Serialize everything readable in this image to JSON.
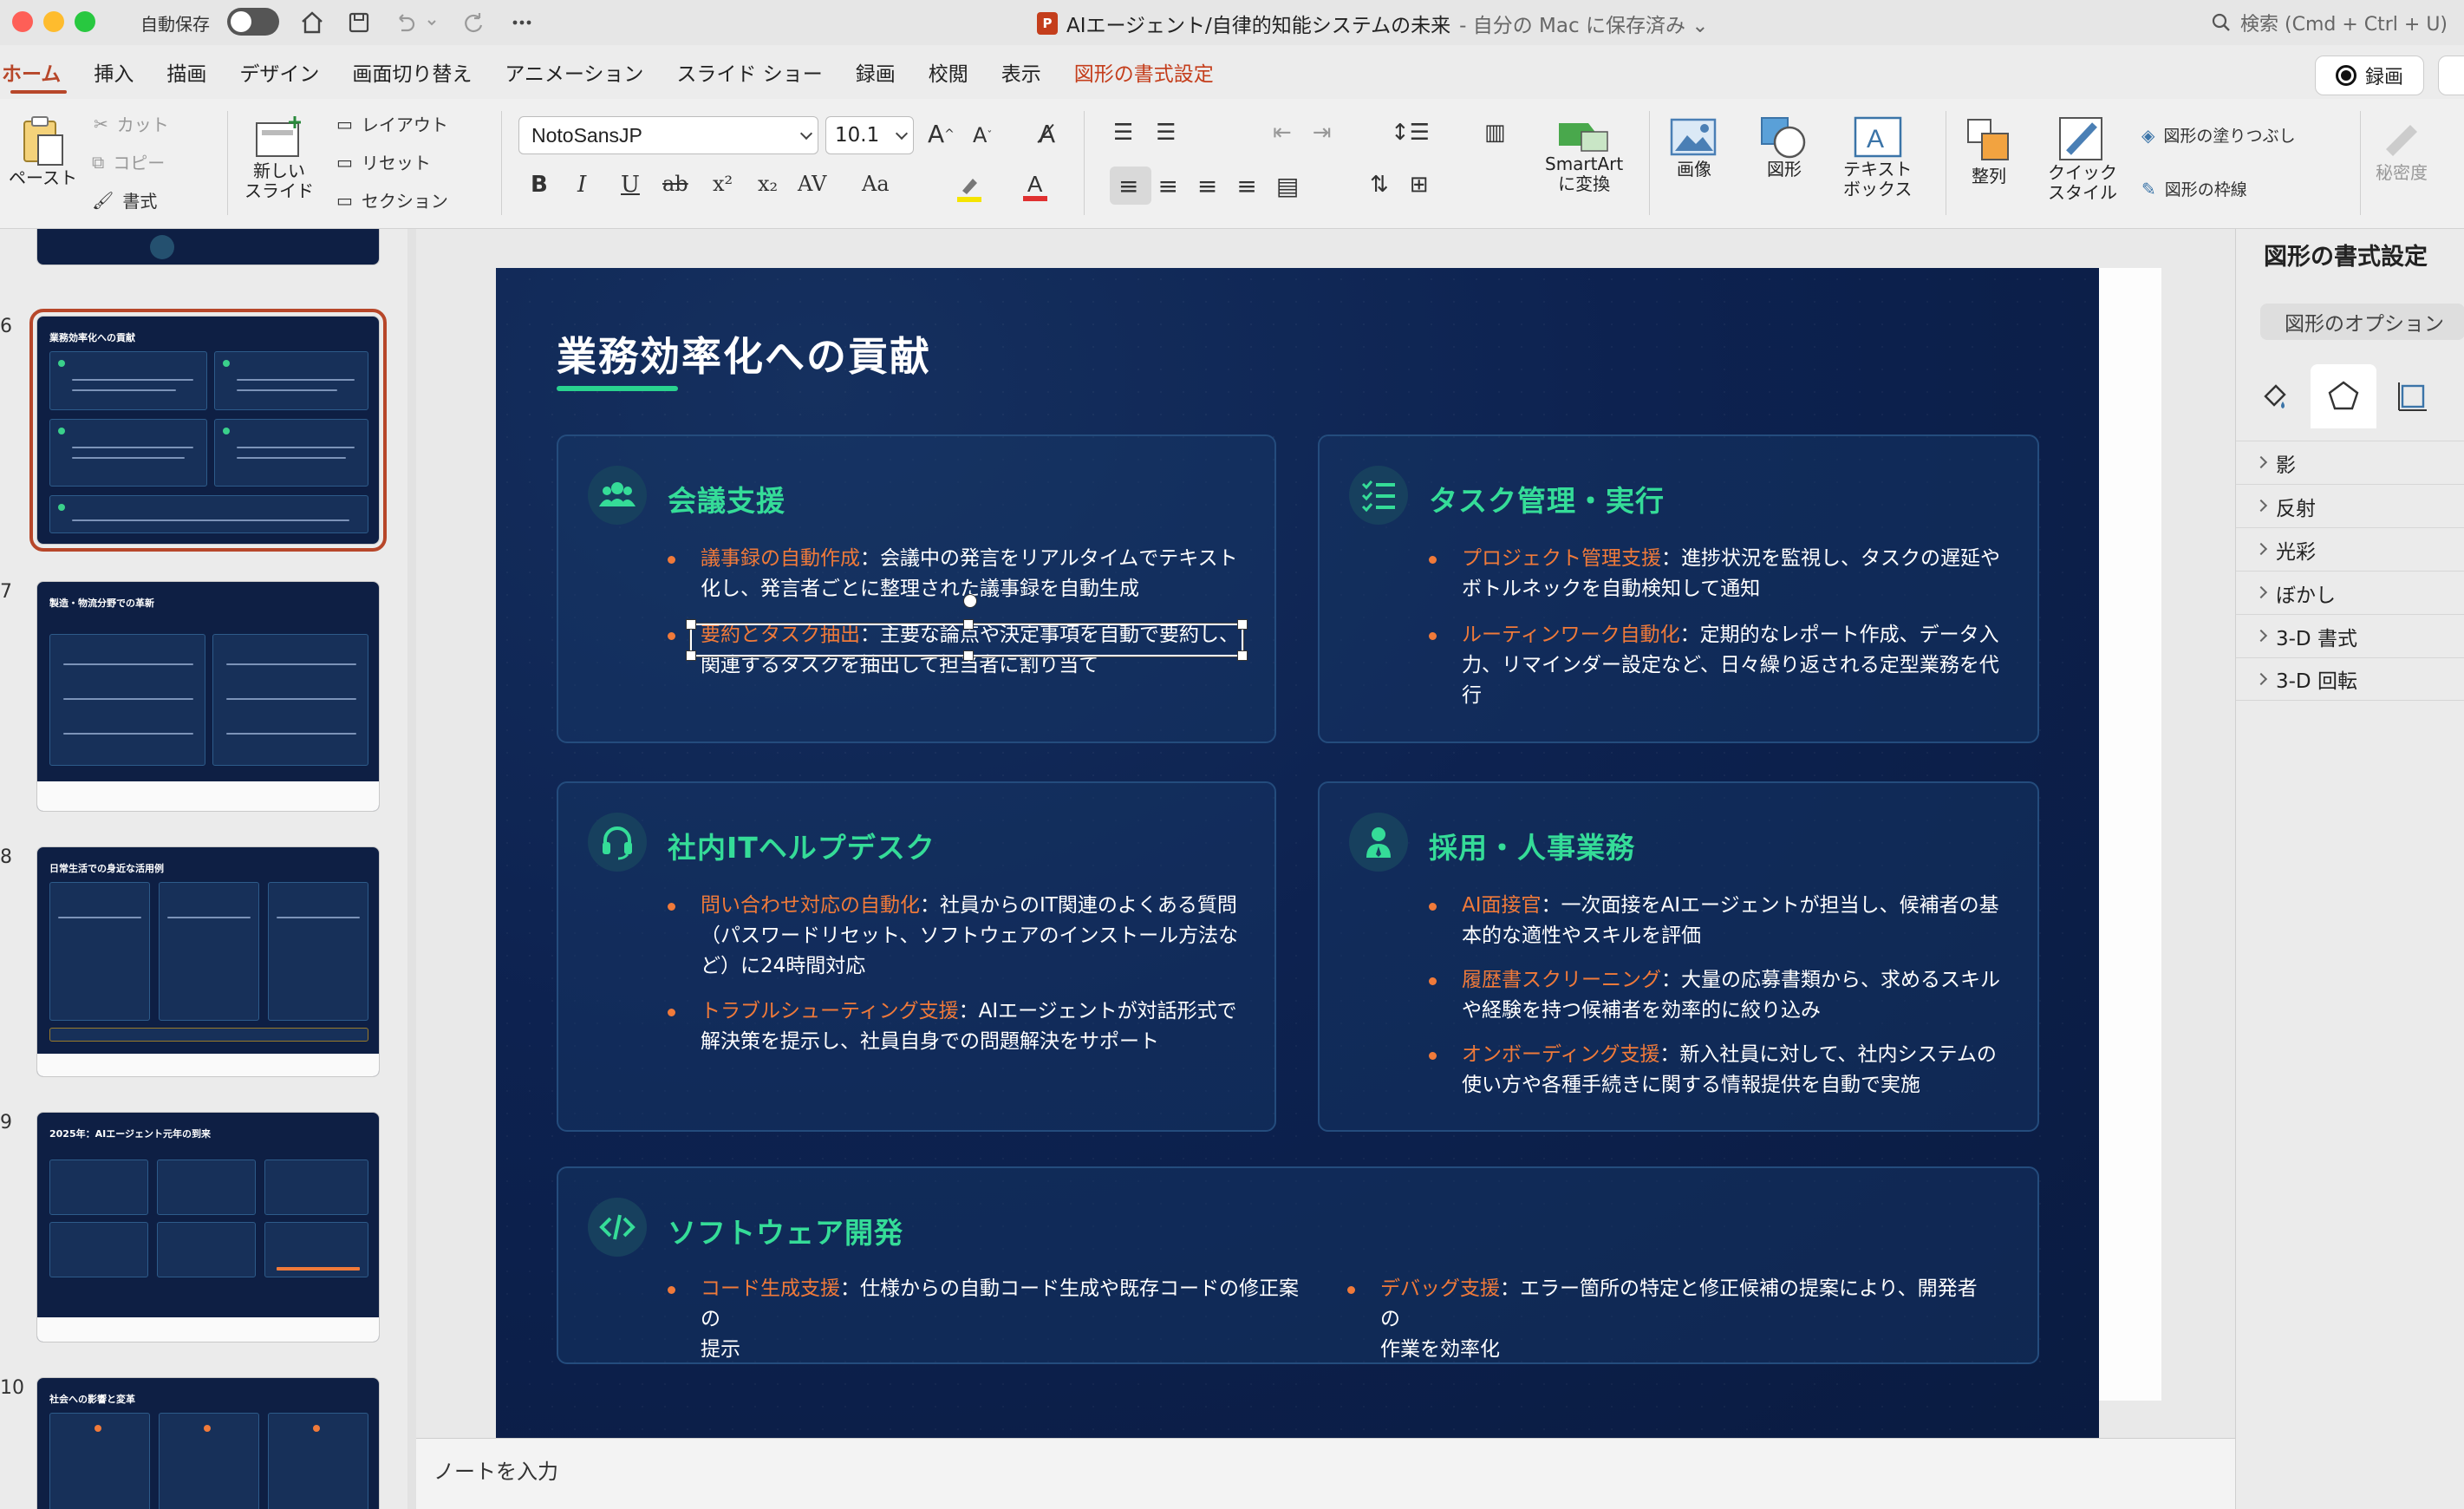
{
  "titlebar": {
    "autosave_label": "自動保存",
    "doc_title": "AIエージェント/自律的知能システムの未来",
    "doc_subtitle": "- 自分の Mac に保存済み ⌄",
    "search_placeholder": "検索 (Cmd + Ctrl + U)"
  },
  "tabs": [
    {
      "label": "ホーム"
    },
    {
      "label": "挿入"
    },
    {
      "label": "描画"
    },
    {
      "label": "デザイン"
    },
    {
      "label": "画面切り替え"
    },
    {
      "label": "アニメーション"
    },
    {
      "label": "スライド ショー"
    },
    {
      "label": "録画"
    },
    {
      "label": "校閲"
    },
    {
      "label": "表示"
    },
    {
      "label": "図形の書式設定"
    }
  ],
  "record_label": "録画",
  "ribbon": {
    "paste": "ペースト",
    "cut": "カット",
    "copy": "コピー",
    "format": "書式",
    "new_slide_1": "新しい",
    "new_slide_2": "スライド",
    "layout": "レイアウト",
    "reset": "リセット",
    "section": "セクション",
    "font_name": "NotoSansJP",
    "font_size": "10.1",
    "smartart_1": "SmartArt",
    "smartart_2": "に変換",
    "image": "画像",
    "shape": "図形",
    "textbox_1": "テキスト",
    "textbox_2": "ボックス",
    "arrange": "整列",
    "quick_style_1": "クイック",
    "quick_style_2": "スタイル",
    "shape_fill": "図形の塗りつぶし",
    "shape_outline": "図形の枠線",
    "sensitivity": "秘密度",
    "colors": {
      "highlight": "#f5e400",
      "font_color": "#e03030"
    }
  },
  "thumbnails": [
    {
      "num": "6",
      "title": "業務効率化への貢献"
    },
    {
      "num": "7",
      "title": "製造・物流分野での革新"
    },
    {
      "num": "8",
      "title": "日常生活での身近な活用例"
    },
    {
      "num": "9",
      "title": "2025年：AIエージェント元年の到来"
    },
    {
      "num": "10",
      "title": "社会への影響と変革"
    }
  ],
  "slide": {
    "title": "業務効率化への貢献",
    "colors": {
      "accent_green": "#35dc98",
      "accent_orange": "#f07a3a",
      "bg": "#0d2250"
    },
    "cards": [
      {
        "icon": "people-icon",
        "title": "会議支援",
        "bullets": [
          {
            "hl": "議事録の自動作成",
            "l1": "：会議中の発言をリアルタイムでテキスト",
            "l2": "化し、発言者ごとに整理された議事録を自動生成",
            "l3": ""
          },
          {
            "hl": "要約とタスク抽出",
            "l1": "：主要な論点や決定事項を自動で要約し、",
            "l2": "関連するタスクを抽出して担当者に割り当て",
            "l3": ""
          }
        ]
      },
      {
        "icon": "checklist-icon",
        "title": "タスク管理・実行",
        "bullets": [
          {
            "hl": "プロジェクト管理支援",
            "l1": "：進捗状況を監視し、タスクの遅延や",
            "l2": "ボトルネックを自動検知して通知",
            "l3": ""
          },
          {
            "hl": "ルーティンワーク自動化",
            "l1": "：定期的なレポート作成、データ入",
            "l2": "力、リマインダー設定など、日々繰り返される定型業務を代",
            "l3": "行"
          }
        ]
      },
      {
        "icon": "headset-icon",
        "title": "社内ITヘルプデスク",
        "bullets": [
          {
            "hl": "問い合わせ対応の自動化",
            "l1": "：社員からのIT関連のよくある質問",
            "l2": "（パスワードリセット、ソフトウェアのインストール方法な",
            "l3": "ど）に24時間対応"
          },
          {
            "hl": "トラブルシューティング支援",
            "l1": "：AIエージェントが対話形式で",
            "l2": "解決策を提示し、社員自身での問題解決をサポート",
            "l3": ""
          }
        ]
      },
      {
        "icon": "person-icon",
        "title": "採用・人事業務",
        "bullets": [
          {
            "hl": "AI面接官",
            "l1": "：一次面接をAIエージェントが担当し、候補者の基",
            "l2": "本的な適性やスキルを評価",
            "l3": ""
          },
          {
            "hl": "履歴書スクリーニング",
            "l1": "：大量の応募書類から、求めるスキル",
            "l2": "や経験を持つ候補者を効率的に絞り込み",
            "l3": ""
          },
          {
            "hl": "オンボーディング支援",
            "l1": "：新入社員に対して、社内システムの",
            "l2": "使い方や各種手続きに関する情報提供を自動で実施",
            "l3": ""
          }
        ]
      },
      {
        "icon": "code-icon",
        "title": "ソフトウェア開発",
        "bullets": [
          {
            "hl": "コード生成支援",
            "l1": "：仕様からの自動コード生成や既存コードの修正案の",
            "l2": "提示",
            "l3": ""
          },
          {
            "hl": "デバッグ支援",
            "l1": "：エラー箇所の特定と修正候補の提案により、開発者の",
            "l2": "作業を効率化",
            "l3": ""
          }
        ]
      }
    ]
  },
  "notes_placeholder": "ノートを入力",
  "right_panel": {
    "title": "図形の書式設定",
    "tab": "図形のオプション",
    "items": [
      {
        "label": "影"
      },
      {
        "label": "反射"
      },
      {
        "label": "光彩"
      },
      {
        "label": "ぼかし"
      },
      {
        "label": "3-D 書式"
      },
      {
        "label": "3-D 回転"
      }
    ]
  }
}
